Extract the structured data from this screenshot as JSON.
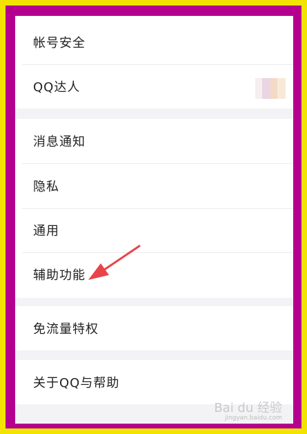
{
  "settings": {
    "account_security": "帐号安全",
    "qq_expert": "QQ达人",
    "message_notify": "消息通知",
    "privacy": "隐私",
    "general": "通用",
    "accessibility": "辅助功能",
    "free_data": "免流量特权",
    "about_help": "关于QQ与帮助"
  },
  "watermark": {
    "brand": "Bai du 经验",
    "url": "jingyan.baidu.com"
  },
  "colors": {
    "outer_border": "#f2e400",
    "inner_border": "#b5008f",
    "arrow": "#e8444a"
  }
}
